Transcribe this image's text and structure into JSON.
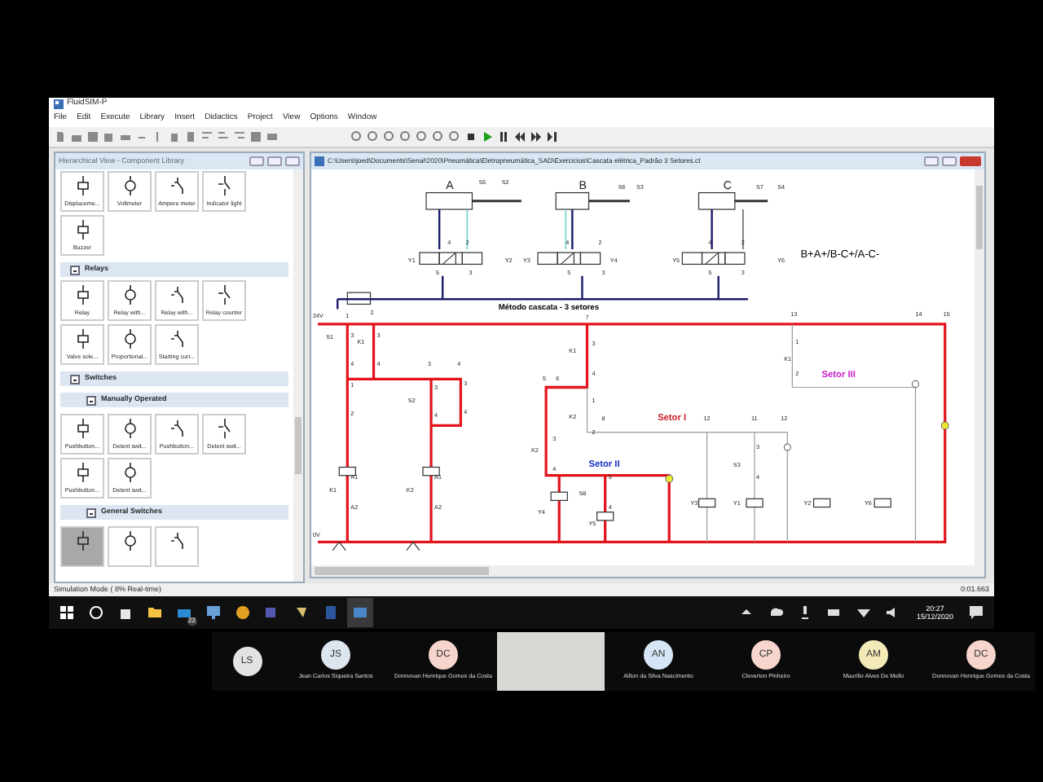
{
  "app": {
    "title": "FluidSIM-P",
    "menu": [
      "File",
      "Edit",
      "Execute",
      "Library",
      "Insert",
      "Didactics",
      "Project",
      "View",
      "Options",
      "Window"
    ]
  },
  "library": {
    "title": "Hierarchical View - Component Library",
    "sections": [
      {
        "tiles": [
          {
            "label": "Displaceme...",
            "selected": false
          },
          {
            "label": "Voltmeter",
            "selected": false
          },
          {
            "label": "Ampere meter",
            "selected": false
          },
          {
            "label": "Indicator light",
            "selected": false
          },
          {
            "label": "Buzzer",
            "selected": false
          }
        ]
      },
      {
        "label": "Relays",
        "expanded": true,
        "tiles": [
          {
            "label": "Relay",
            "selected": false
          },
          {
            "label": "Relay with...",
            "selected": false
          },
          {
            "label": "Relay with...",
            "selected": false
          },
          {
            "label": "Relay counter",
            "selected": false
          },
          {
            "label": "Valve sole...",
            "selected": false
          },
          {
            "label": "Proportional...",
            "selected": false
          },
          {
            "label": "Starting curr...",
            "selected": false
          }
        ]
      },
      {
        "label": "Switches",
        "expanded": true,
        "children": [
          {
            "label": "Manually Operated",
            "expanded": true,
            "tiles": [
              {
                "label": "Pushbutton...",
                "selected": false
              },
              {
                "label": "Detent swit...",
                "selected": false
              },
              {
                "label": "Pushbutton...",
                "selected": false
              },
              {
                "label": "Detent swit...",
                "selected": false
              },
              {
                "label": "Pushbutton...",
                "selected": false
              },
              {
                "label": "Detent swit...",
                "selected": false
              }
            ]
          },
          {
            "label": "General Switches",
            "expanded": true,
            "tiles": [
              {
                "selected": true
              },
              {
                "selected": false
              },
              {
                "selected": false
              }
            ]
          }
        ]
      }
    ]
  },
  "document": {
    "title": "C:\\Users\\joed\\Documents\\Senai\\2020\\Pneumática\\Eletropneumática_SAD\\Exercicios\\Cascata elétrica_Padrão 3 Setores.ct",
    "sequence": "B+A+/B-C+/A-C-",
    "caption": "Método cascata - 3 setores",
    "labels": [
      "A",
      "S5",
      "S2",
      "B",
      "S6",
      "S3",
      "C",
      "S7",
      "S4",
      "4",
      "2",
      "5",
      "3",
      "4",
      "2",
      "5",
      "3",
      "4",
      "2",
      "5",
      "3",
      "Y1",
      "Y2",
      "Y3",
      "Y4",
      "Y5",
      "Y6",
      "2",
      "24V",
      "1",
      "7",
      "13",
      "14",
      "15",
      "S1",
      "K1",
      "3",
      "4",
      "3",
      "4",
      "3",
      "4",
      "1",
      "2",
      "S2",
      "3",
      "4",
      "3",
      "4",
      "K1",
      "A1",
      "A2",
      "K2",
      "A1",
      "A2",
      "0V",
      "K1",
      "3",
      "4",
      "5",
      "6",
      "1",
      "K2",
      "8",
      "2",
      "K2",
      "3",
      "4",
      "5",
      "S8",
      "4",
      "Y4",
      "Y5",
      "12",
      "11",
      "12",
      "3",
      "S3",
      "4",
      "Y3",
      "Y1",
      "Y2",
      "Y6",
      "1",
      "K1",
      "2"
    ],
    "sectors": [
      {
        "label": "Setor I",
        "color": "#c8242b"
      },
      {
        "label": "Setor II",
        "color": "#1c2fc4"
      },
      {
        "label": "Setor III",
        "color": "#c81ec8"
      }
    ]
  },
  "status_bar": {
    "mode": "Simulation Mode ( 8% Real-time)",
    "time": "0:01.663"
  },
  "taskbar": {
    "mail_badge": "22",
    "time": "20:27",
    "date": "15/12/2020"
  },
  "participants": [
    {
      "kind": "avatar",
      "initials": "LS",
      "color": "#e3e3e3"
    },
    {
      "kind": "avatar",
      "initials": "JS",
      "name": "Jean Carlos Siqueira Santos",
      "color": "#dde6ee"
    },
    {
      "kind": "avatar",
      "initials": "DC",
      "name": "Donnovan Henrique Gomes da Costa",
      "color": "#f6d6cc"
    },
    {
      "kind": "video"
    },
    {
      "kind": "avatar",
      "initials": "AN",
      "name": "Ailton da Silva Nascimento",
      "color": "#d6e6f6"
    },
    {
      "kind": "avatar",
      "initials": "CP",
      "name": "Cleverton Pinheiro",
      "color": "#f6d6cc"
    },
    {
      "kind": "avatar",
      "initials": "AM",
      "name": "Maurilio Alves De Mello",
      "color": "#f4eab8"
    },
    {
      "kind": "avatar",
      "initials": "DC",
      "name": "Donnovan Henrique Gomes da Costa",
      "color": "#f6d6cc"
    }
  ]
}
